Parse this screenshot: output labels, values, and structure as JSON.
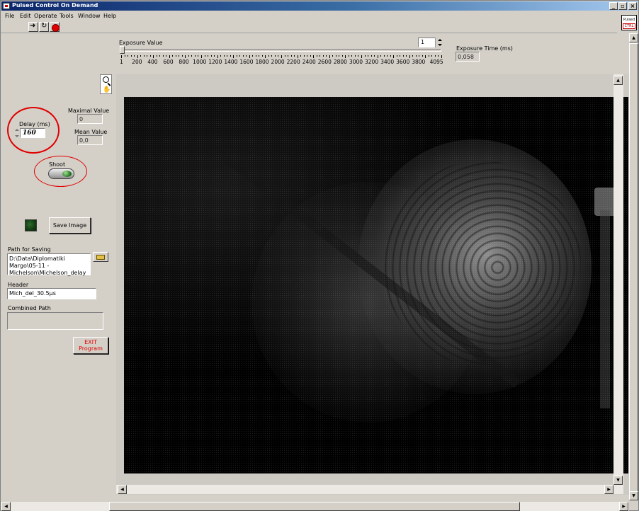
{
  "window": {
    "title": "Pulsed Control On Demand"
  },
  "menu": [
    "File",
    "Edit",
    "Operate",
    "Tools",
    "Window",
    "Help"
  ],
  "vi_icon": {
    "line1": "Pulsed",
    "line2": "CTRL"
  },
  "exposure": {
    "label": "Exposure Value",
    "value": "1",
    "slider_fraction": 0.0,
    "ticks": [
      "1",
      "200",
      "400",
      "600",
      "800",
      "1000",
      "1200",
      "1400",
      "1600",
      "1800",
      "2000",
      "2200",
      "2400",
      "2600",
      "2800",
      "3000",
      "3200",
      "3400",
      "3600",
      "3800",
      "4095"
    ],
    "time_label": "Exposure Time (ms)",
    "time_value": "0,058"
  },
  "stats": {
    "max_label": "Maximal Value",
    "max_value": "0",
    "mean_label": "Mean Value",
    "mean_value": "0,0"
  },
  "delay": {
    "label": "Delay (ms)",
    "value": "160"
  },
  "shoot": {
    "label": "Shoot"
  },
  "save": {
    "button_label": "Save Image"
  },
  "path": {
    "label": "Path for Saving",
    "value": "D:\\Data\\Diplomatiki Margo\\05-11 - Michelson\\Michelson_delay"
  },
  "header": {
    "label": "Header",
    "value": "Mich_del_30.5µs"
  },
  "combined": {
    "label": "Combined Path",
    "value": ""
  },
  "exit": {
    "line1": "EXIT",
    "line2": "Program"
  },
  "colors": {
    "panel": "#d4d0c8",
    "highlight_ring": "#e00000",
    "title_bar": "#0a246a"
  }
}
